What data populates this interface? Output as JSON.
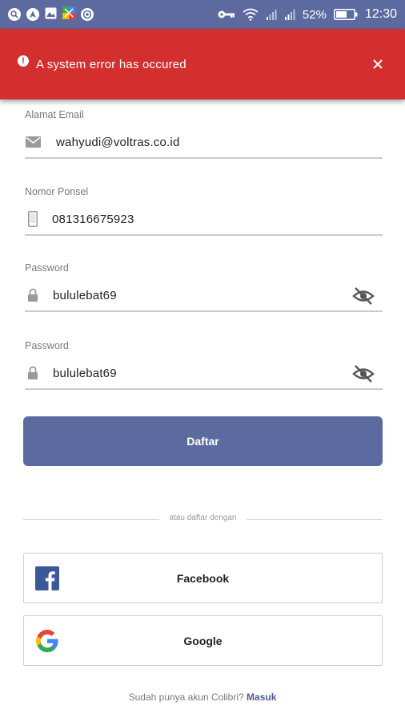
{
  "status_bar": {
    "battery": "52%",
    "time": "12:30",
    "icons": [
      "search-icon",
      "navigation-icon",
      "image-icon",
      "maps-icon",
      "chrome-icon",
      "key-icon",
      "wifi-icon",
      "signal-icon",
      "signal-icon",
      "battery-icon"
    ]
  },
  "error": {
    "message": "A system error has occured",
    "color": "#d42f2f"
  },
  "form": {
    "email": {
      "label": "Alamat Email",
      "value": "wahyudi@voltras.co.id"
    },
    "phone": {
      "label": "Nomor Ponsel",
      "value": "081316675923"
    },
    "password": {
      "label": "Password",
      "value": "bululebat69"
    },
    "confirm_password": {
      "label": "Password",
      "value": "bululebat69"
    }
  },
  "buttons": {
    "register": "Daftar"
  },
  "divider": "atau daftar dengan",
  "social": {
    "facebook": "Facebook",
    "google": "Google"
  },
  "footer": {
    "text": "Sudah punya akun Colibri?",
    "link": "Masuk"
  },
  "colors": {
    "primary": "#5d6aa0",
    "error": "#d42f2f"
  }
}
